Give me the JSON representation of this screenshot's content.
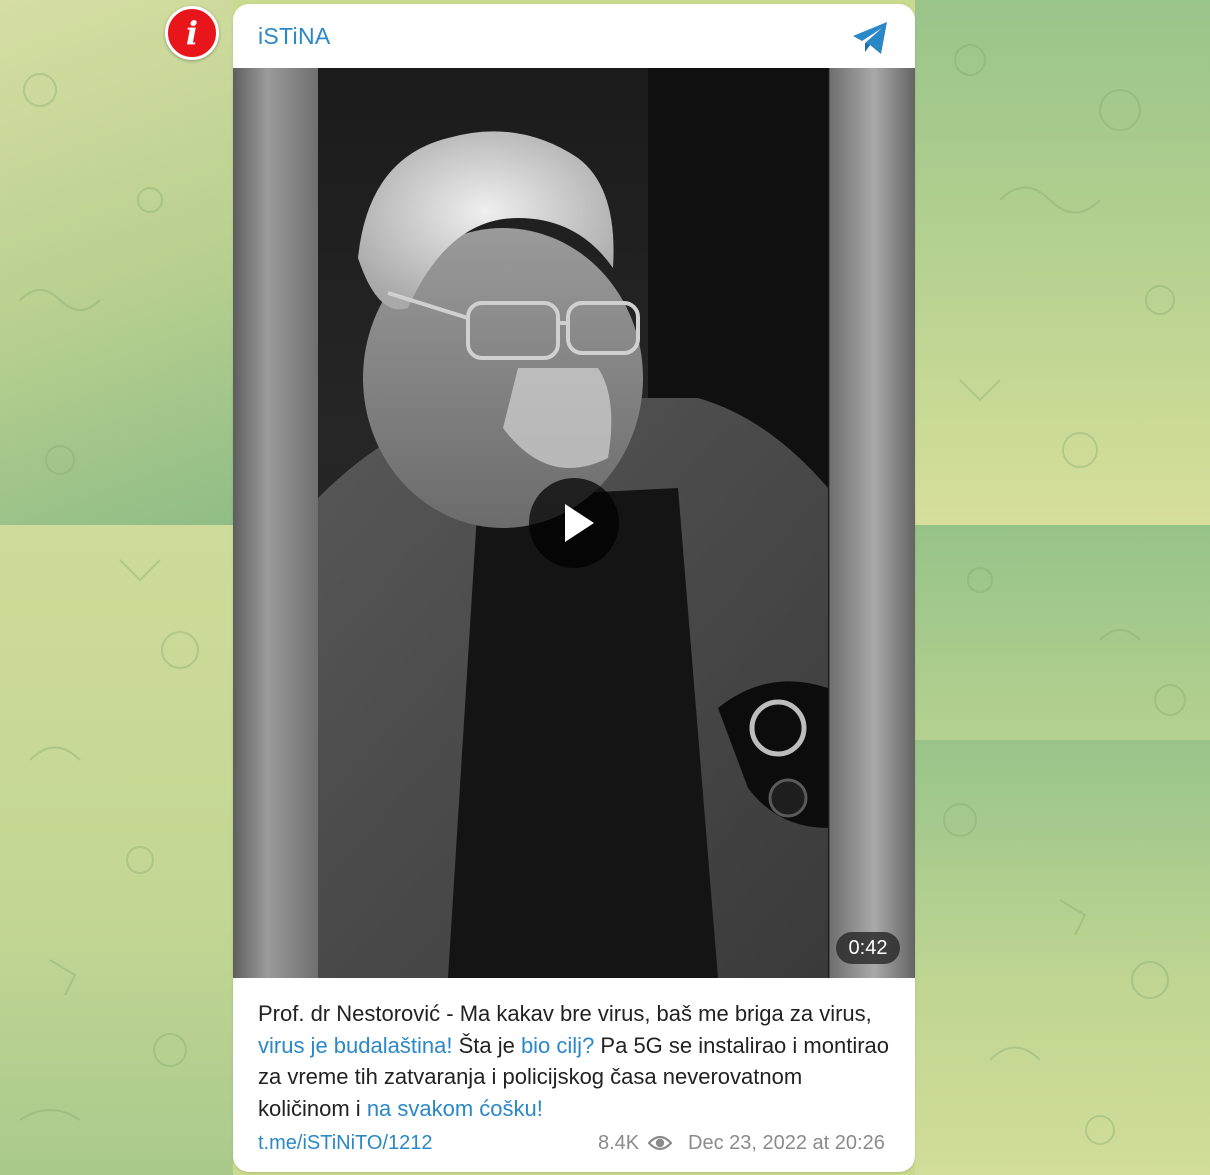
{
  "channel": {
    "name": "iSTiNA"
  },
  "info_badge": {
    "glyph": "i"
  },
  "video": {
    "duration": "0:42"
  },
  "caption": {
    "segments": [
      {
        "text": "Prof. dr Nestorović - Ma kakav bre virus, baš me briga za virus, ",
        "link": false
      },
      {
        "text": "virus je budalaština!",
        "link": true
      },
      {
        "text": " Šta je ",
        "link": false
      },
      {
        "text": "bio cilj?",
        "link": true
      },
      {
        "text": " Pa 5G se instalirao i montirao za vreme tih zatvaranja i policijskog časa neverovatnom količinom i ",
        "link": false
      },
      {
        "text": "na svakom ćošku!",
        "link": true
      }
    ]
  },
  "footer": {
    "post_link": "t.me/iSTiNiTO/1212",
    "views": "8.4K",
    "timestamp": "Dec 23, 2022 at 20:26"
  },
  "colors": {
    "accent": "#2a88c7",
    "badge_red": "#e8151b",
    "meta_gray": "#8b8b8b",
    "bg_green_light": "#d3dc9c",
    "bg_green_dark": "#9cc38a"
  },
  "icons": {
    "header": "telegram-plane-icon",
    "play": "play-icon",
    "views": "eye-icon",
    "badge": "info-icon"
  }
}
